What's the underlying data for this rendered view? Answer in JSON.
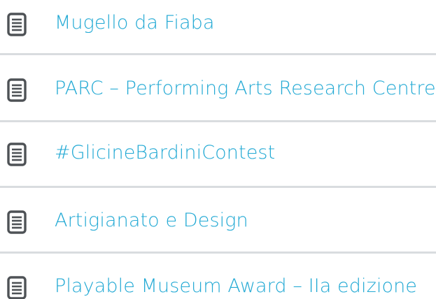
{
  "colors": {
    "link": "#22a9d4",
    "icon": "#4e5256",
    "divider": "#d9dcdf"
  },
  "items": [
    {
      "label": "Mugello da Fiaba",
      "icon": "document-icon"
    },
    {
      "label": "PARC – Performing Arts Research Centre",
      "icon": "document-icon"
    },
    {
      "label": "#GlicineBardiniContest",
      "icon": "document-icon"
    },
    {
      "label": "Artigianato e Design",
      "icon": "document-icon"
    },
    {
      "label": "Playable Museum Award – IIa edizione",
      "icon": "document-icon"
    }
  ]
}
